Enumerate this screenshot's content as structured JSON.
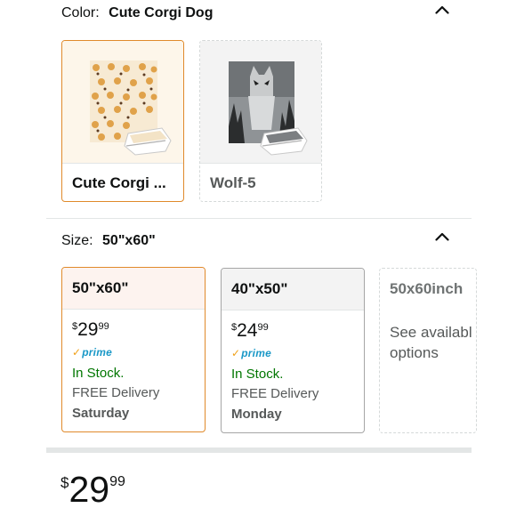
{
  "color_selector": {
    "label": "Color:",
    "selected_value": "Cute Corgi Dog",
    "options": [
      {
        "label": "Cute Corgi ...",
        "state": "selected"
      },
      {
        "label": "Wolf-5",
        "state": "unavailable"
      }
    ]
  },
  "size_selector": {
    "label": "Size:",
    "selected_value": "50\"x60\"",
    "options": [
      {
        "title": "50\"x60\"",
        "price_symbol": "$",
        "price_whole": "29",
        "price_fraction": "99",
        "prime": "prime",
        "stock": "In Stock.",
        "delivery": "FREE Delivery",
        "day": "Saturday",
        "state": "selected"
      },
      {
        "title": "40\"x50\"",
        "price_symbol": "$",
        "price_whole": "24",
        "price_fraction": "99",
        "prime": "prime",
        "stock": "In Stock.",
        "delivery": "FREE Delivery",
        "day": "Monday",
        "state": "normal"
      },
      {
        "title": "50x60inch",
        "see_line1": "See availabl",
        "see_line2": "options",
        "state": "unavailable"
      }
    ]
  },
  "price": {
    "symbol": "$",
    "whole": "29",
    "fraction": "99"
  },
  "colors": {
    "selected_border": "#e08a2b",
    "in_stock": "#007600",
    "prime_blue": "#1a98c7",
    "prime_check": "#f0a018"
  }
}
